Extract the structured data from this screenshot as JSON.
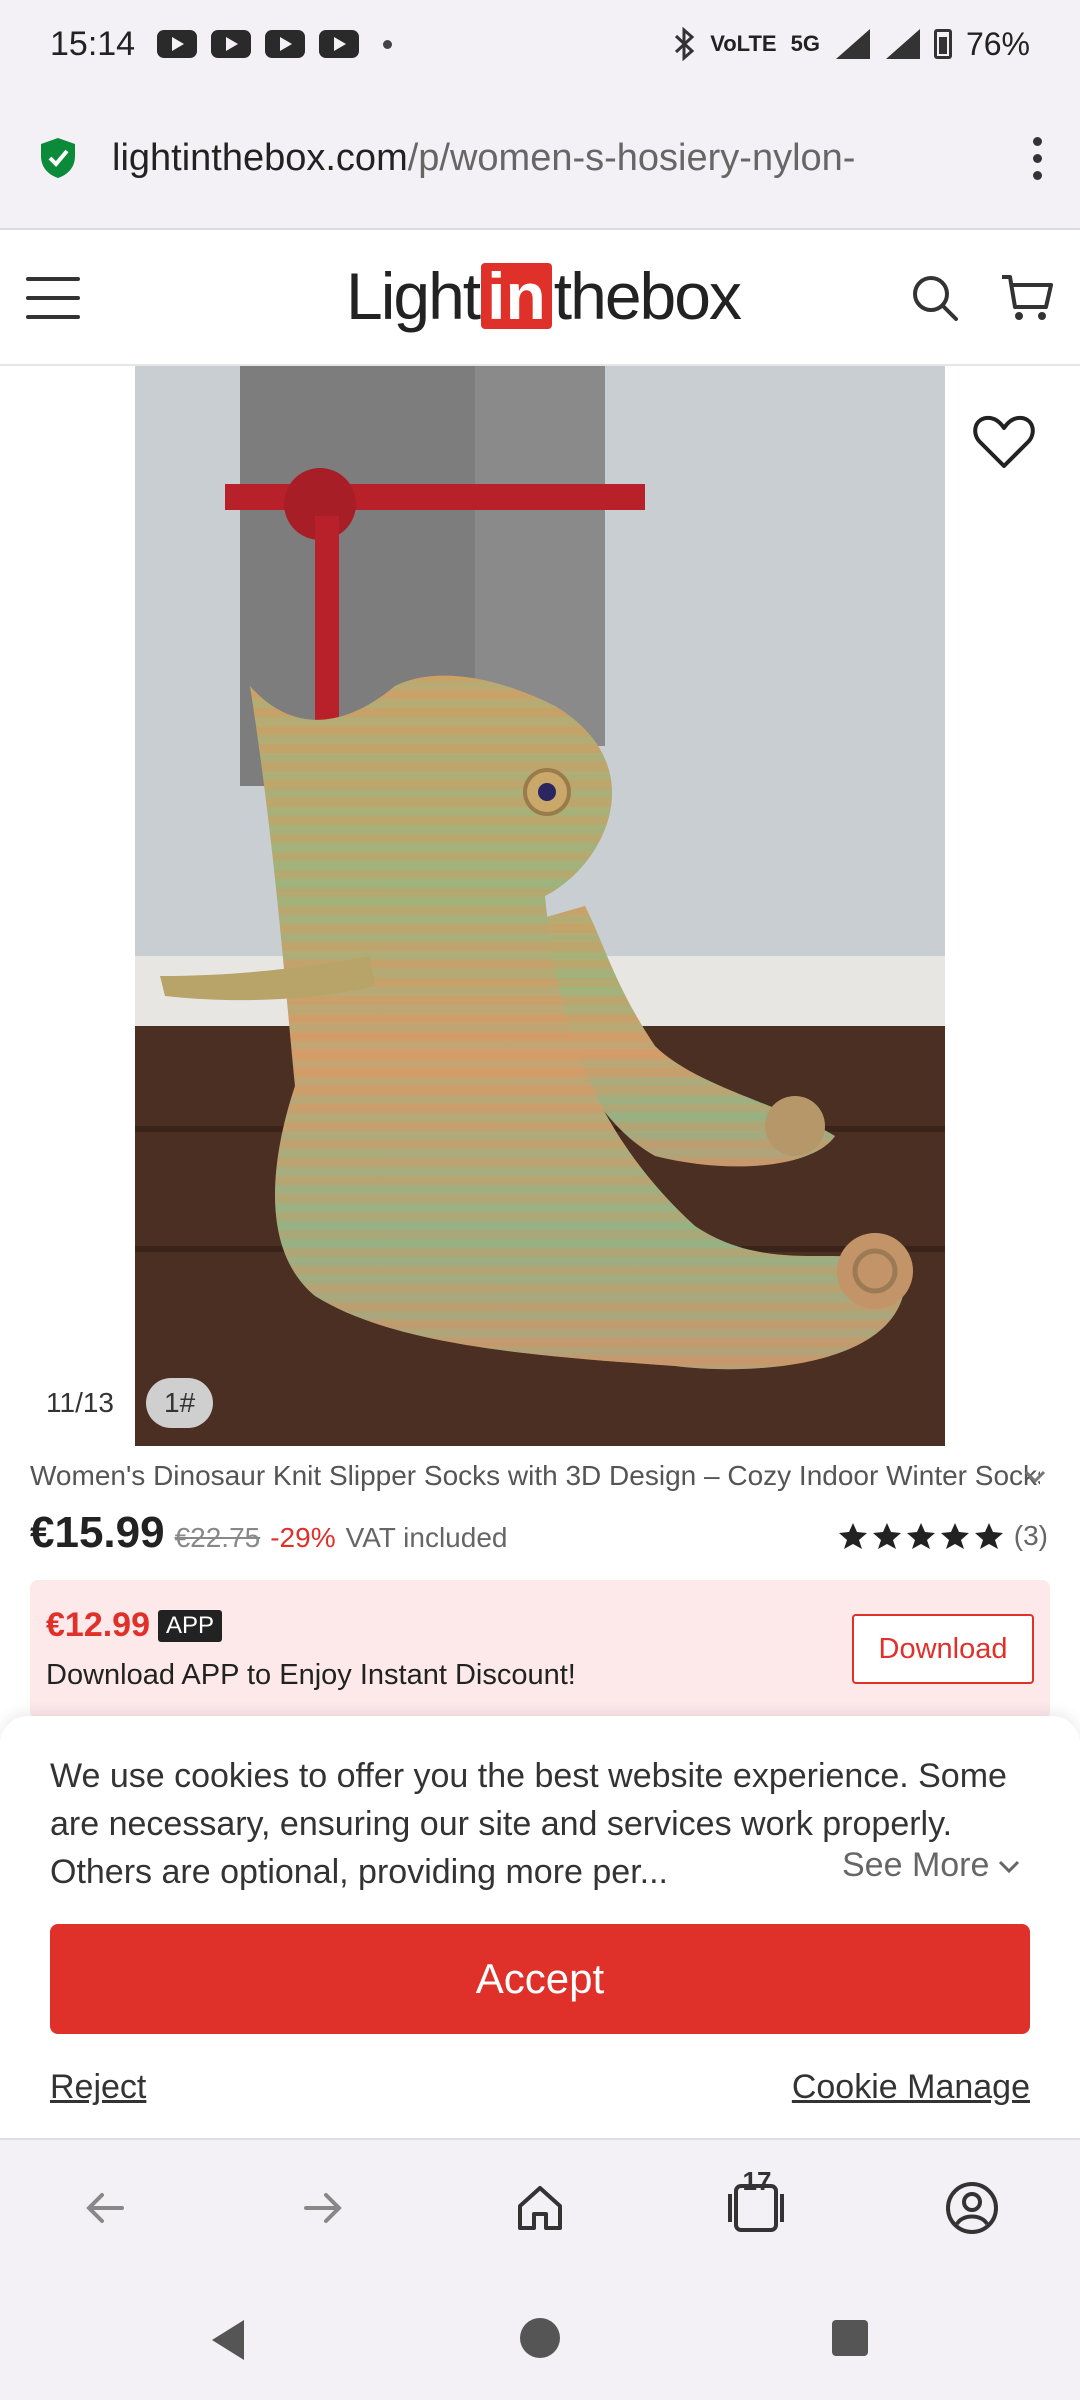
{
  "status_bar": {
    "time": "15:14",
    "network": "5G",
    "volte": "VoLTE",
    "battery": "76%"
  },
  "url_bar": {
    "host": "lightinthebox.com",
    "path": "/p/women-s-hosiery-nylon-"
  },
  "header": {
    "logo_light": "Light",
    "logo_in": "in",
    "logo_thebox": "thebox"
  },
  "gallery": {
    "counter": "11/13",
    "tag": "1#"
  },
  "product": {
    "title": "Women's Dinosaur Knit Slipper Socks with 3D Design – Cozy Indoor Winter Socks",
    "price": "€15.99",
    "old_price": "€22.75",
    "discount": "-29%",
    "vat": "VAT included",
    "rating_stars": 5,
    "rating_count": "(3)"
  },
  "app_promo": {
    "price": "€12.99",
    "badge": "APP",
    "text": "Download APP to Enjoy Instant Discount!",
    "button": "Download"
  },
  "cookie": {
    "text": "We use cookies to offer you the best website experience. Some are necessary, ensuring our site and services work properly. Others are optional, providing more per...",
    "see_more": "See More",
    "accept": "Accept",
    "reject": "Reject",
    "manage": "Cookie Manage"
  },
  "browser_nav": {
    "tab_count": "17"
  },
  "colors": {
    "brand_red": "#e0302a",
    "promo_bg": "#fde9ea"
  }
}
